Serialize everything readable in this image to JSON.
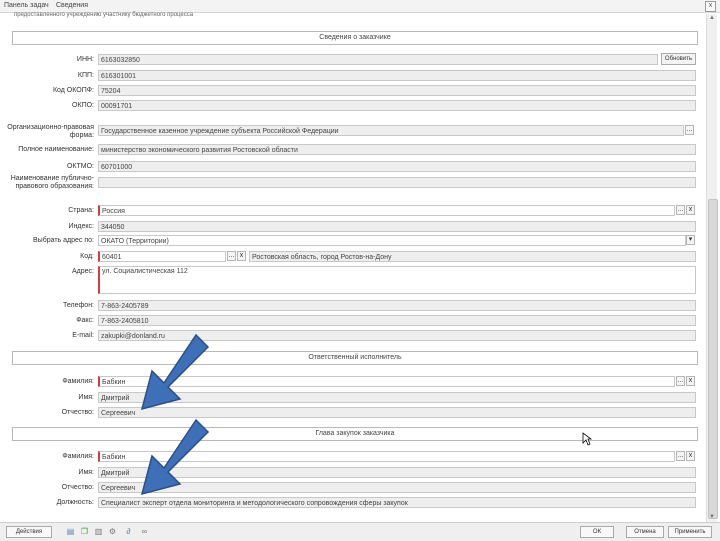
{
  "window": {
    "tabs": [
      "Панель задач",
      "Сведения"
    ],
    "close": "x",
    "top_line": "предоставленного учреждению участнику бюджетного процесса"
  },
  "sections": {
    "customer": "Сведения о заказчике",
    "executor": "Ответственный исполнитель",
    "head": "Глава закупок заказчика"
  },
  "customer": {
    "inn": {
      "label": "ИНН:",
      "value": "6163032850"
    },
    "kpp": {
      "label": "КПП:",
      "value": "616301001"
    },
    "okopf": {
      "label": "Код ОКОПФ:",
      "value": "75204"
    },
    "okpo": {
      "label": "ОКПО:",
      "value": "00091701"
    },
    "org_form": {
      "label": "Организационно-правовая форма:",
      "value": "Государственное казенное учреждение субъекта Российской Федерации"
    },
    "full_name": {
      "label": "Полное наименование:",
      "value": "министерство экономического развития Ростовской области"
    },
    "oktmo": {
      "label": "ОКТМО:",
      "value": "60701000"
    },
    "public_entity": {
      "label": "Наименование публично-правового образования:",
      "value": ""
    },
    "country": {
      "label": "Страна:",
      "value": "Россия"
    },
    "index": {
      "label": "Индекс:",
      "value": "344050"
    },
    "address_type": {
      "label": "Выбрать адрес по:",
      "value": "ОКАТО (Территории)"
    },
    "code": {
      "label": "Код:",
      "value": "60401",
      "description": "Ростовская область, город Ростов-на-Дону"
    },
    "address": {
      "label": "Адрес:",
      "value": "ул. Социалистическая 112"
    },
    "phone": {
      "label": "Телефон:",
      "value": "7-863-2405789"
    },
    "fax": {
      "label": "Факс:",
      "value": "7-863-2405810"
    },
    "email": {
      "label": "E-mail:",
      "value": "zakupki@donland.ru"
    }
  },
  "executor": {
    "lastname": {
      "label": "Фамилия:",
      "value": "Бабкин"
    },
    "firstname": {
      "label": "Имя:",
      "value": "Дмитрий"
    },
    "middlename": {
      "label": "Отчество:",
      "value": "Сергеевич"
    }
  },
  "head": {
    "lastname": {
      "label": "Фамилия:",
      "value": "Бабкин"
    },
    "firstname": {
      "label": "Имя:",
      "value": "Дмитрий"
    },
    "middlename": {
      "label": "Отчество:",
      "value": "Сергеевич"
    },
    "position": {
      "label": "Должность:",
      "value": "Специалист эксперт отдела мониторинга и методологического сопровождения сферы закупок"
    }
  },
  "buttons": {
    "refresh": "Обновить",
    "ellipsis": "...",
    "clear": "x",
    "dropdown": "▾"
  },
  "footer": {
    "actions": "Действия",
    "ok": "ОК",
    "cancel": "Отмена",
    "apply": "Применить"
  },
  "colors": {
    "arrow": "#3f6fb6",
    "arrow_border": "#2b4f86",
    "required": "#d04040"
  }
}
